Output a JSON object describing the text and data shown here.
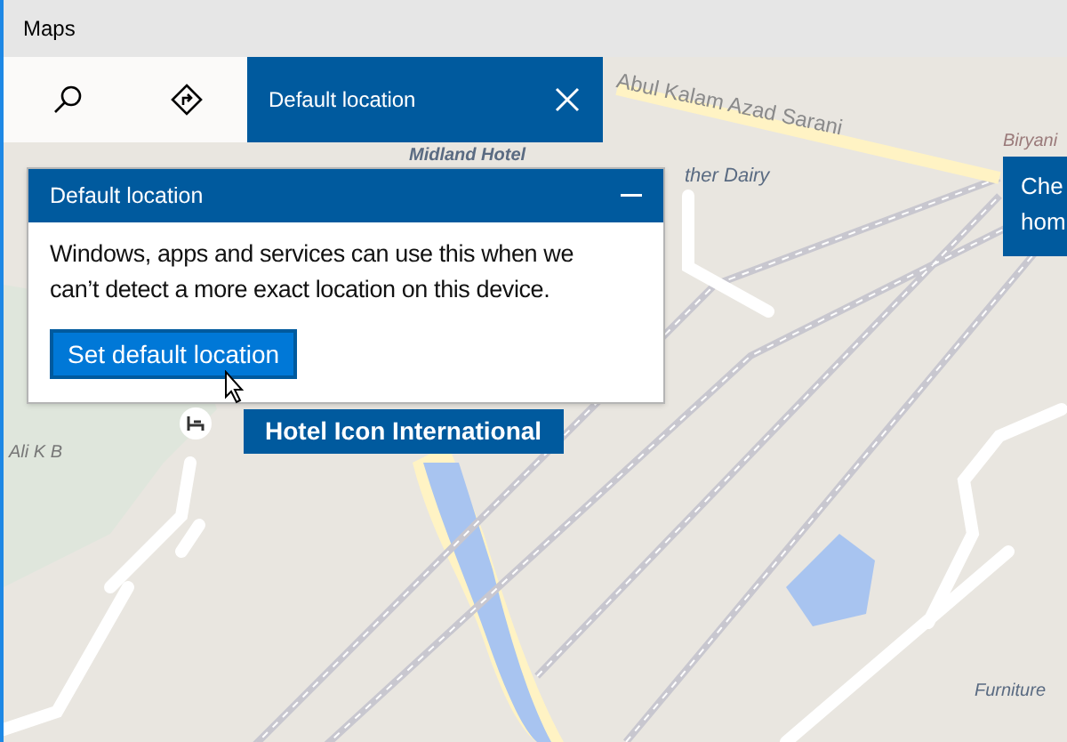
{
  "window": {
    "title": "Maps"
  },
  "toolbar": {
    "panel_title": "Default location"
  },
  "dialog": {
    "title": "Default location",
    "body": "Windows, apps and services can use this when we can’t detect a more exact location on this device.",
    "button": "Set default location"
  },
  "map": {
    "labels": [
      "Abul Kalam Azad Sarani",
      "Midland Hotel",
      "ther Dairy",
      "Biryani",
      "Ali K B",
      "Furniture"
    ],
    "callouts": [
      {
        "text": "Hotel Icon International",
        "kind": "pin"
      },
      {
        "text": "Che\nhom",
        "kind": "edge"
      }
    ]
  }
}
